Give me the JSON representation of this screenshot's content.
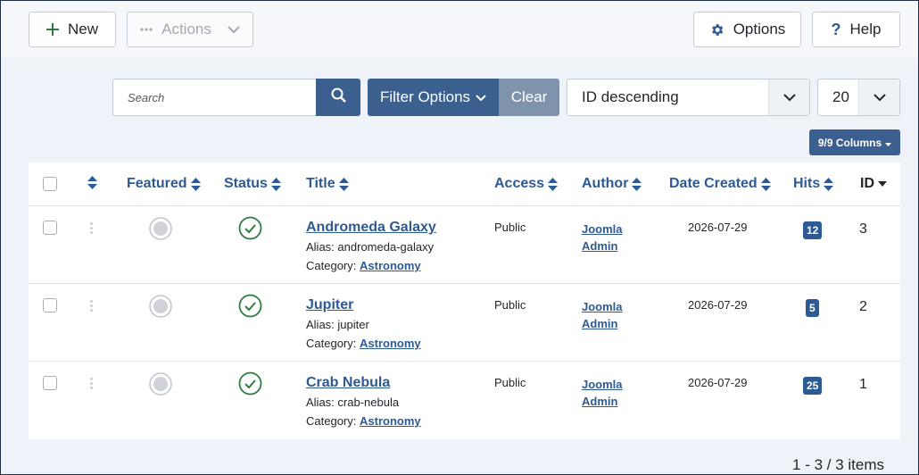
{
  "toolbar": {
    "new_label": "New",
    "actions_label": "Actions",
    "options_label": "Options",
    "help_label": "Help"
  },
  "filters": {
    "search_placeholder": "Search",
    "filter_options_label": "Filter Options",
    "clear_label": "Clear",
    "ordering_value": "ID descending",
    "limit_value": "20",
    "columns_label": "9/9 Columns"
  },
  "table": {
    "headers": {
      "featured": "Featured",
      "status": "Status",
      "title": "Title",
      "access": "Access",
      "author": "Author",
      "date_created": "Date Created",
      "hits": "Hits",
      "id": "ID"
    },
    "alias_label": "Alias:",
    "category_label": "Category:",
    "rows": [
      {
        "title": "Andromeda Galaxy",
        "alias": "andromeda-galaxy",
        "category": "Astronomy",
        "access": "Public",
        "author_line1": "Joomla",
        "author_line2": "Admin",
        "date": "2026-07-29",
        "hits": "12",
        "id": "3"
      },
      {
        "title": "Jupiter",
        "alias": "jupiter",
        "category": "Astronomy",
        "access": "Public",
        "author_line1": "Joomla",
        "author_line2": "Admin",
        "date": "2026-07-29",
        "hits": "5",
        "id": "2"
      },
      {
        "title": "Crab Nebula",
        "alias": "crab-nebula",
        "category": "Astronomy",
        "access": "Public",
        "author_line1": "Joomla",
        "author_line2": "Admin",
        "date": "2026-07-29",
        "hits": "25",
        "id": "1"
      }
    ]
  },
  "pagination": {
    "summary": "1 - 3 / 3 items"
  },
  "colors": {
    "primary": "#3b5f8f",
    "link": "#2d5a93",
    "clear": "#7f93ad",
    "published": "#2e7d3e",
    "background": "#eef2f9"
  }
}
